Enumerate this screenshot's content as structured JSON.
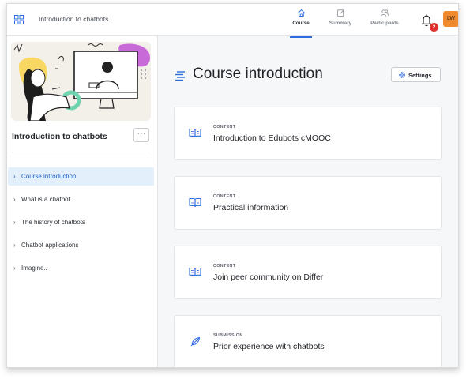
{
  "header": {
    "app_title": "Introduction to chatbots",
    "tabs": [
      {
        "label": "Course",
        "icon": "home-icon",
        "active": true
      },
      {
        "label": "Summary",
        "icon": "edit-square-icon",
        "active": false
      },
      {
        "label": "Participants",
        "icon": "users-icon",
        "active": false
      }
    ],
    "notifications_count": "2",
    "avatar_initials": "LW"
  },
  "sidebar": {
    "course_title": "Introduction to chatbots",
    "more_label": "···",
    "items": [
      {
        "label": "Course introduction",
        "active": true
      },
      {
        "label": "What is a chatbot",
        "active": false
      },
      {
        "label": "The history of chatbots",
        "active": false
      },
      {
        "label": "Chatbot applications",
        "active": false
      },
      {
        "label": "Imagine..",
        "active": false
      }
    ]
  },
  "main": {
    "page_title": "Course introduction",
    "settings_label": "Settings",
    "cards": [
      {
        "kind": "CONTENT",
        "title": "Introduction to Edubots cMOOC",
        "icon": "book-open-icon"
      },
      {
        "kind": "CONTENT",
        "title": "Practical information",
        "icon": "book-open-icon"
      },
      {
        "kind": "CONTENT",
        "title": "Join peer community on Differ",
        "icon": "book-open-icon"
      },
      {
        "kind": "SUBMISSION",
        "title": "Prior experience with chatbots",
        "icon": "feather-pen-icon"
      }
    ]
  },
  "colors": {
    "accent": "#2b6de0",
    "active_nav_bg": "#e4effc",
    "avatar_bg": "#ef8a2f",
    "badge_red": "#e0332e"
  }
}
